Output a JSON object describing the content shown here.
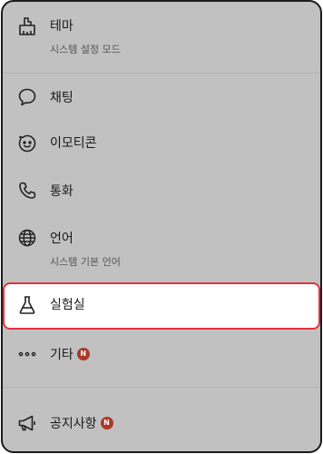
{
  "menu": {
    "theme": {
      "label": "테마",
      "sub": "시스템 설정 모드",
      "icon": "theme-brush-icon"
    },
    "chat": {
      "label": "채팅",
      "icon": "chat-bubble-icon"
    },
    "emoticon": {
      "label": "이모티콘",
      "icon": "smiley-icon"
    },
    "call": {
      "label": "통화",
      "icon": "phone-icon"
    },
    "language": {
      "label": "언어",
      "sub": "시스템 기본 언어",
      "icon": "globe-icon"
    },
    "lab": {
      "label": "실험실",
      "icon": "flask-icon"
    },
    "etc": {
      "label": "기타",
      "badge": "N",
      "icon": "more-dots-icon"
    },
    "notice": {
      "label": "공지사항",
      "badge": "N",
      "icon": "megaphone-icon"
    }
  },
  "colors": {
    "highlight_border": "#e2323e",
    "badge": "#a93a26",
    "background": "#c1c1c1"
  }
}
